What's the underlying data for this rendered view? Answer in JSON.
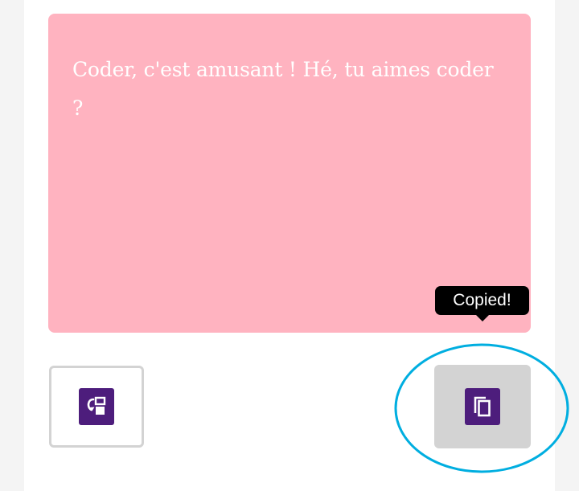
{
  "textbox": {
    "text": "Coder, c'est amusant ! Hé, tu aimes coder ?",
    "background": "#ffb3c0",
    "text_color": "#ffffff"
  },
  "tooltip": {
    "text": "Copied!"
  },
  "buttons": {
    "swap": {
      "icon": "swap-icon",
      "color": "#4d1d7c"
    },
    "copy": {
      "icon": "copy-icon",
      "color": "#4d1d7c",
      "background": "#d3d3d3"
    }
  },
  "highlight": {
    "color": "#00aee0"
  }
}
